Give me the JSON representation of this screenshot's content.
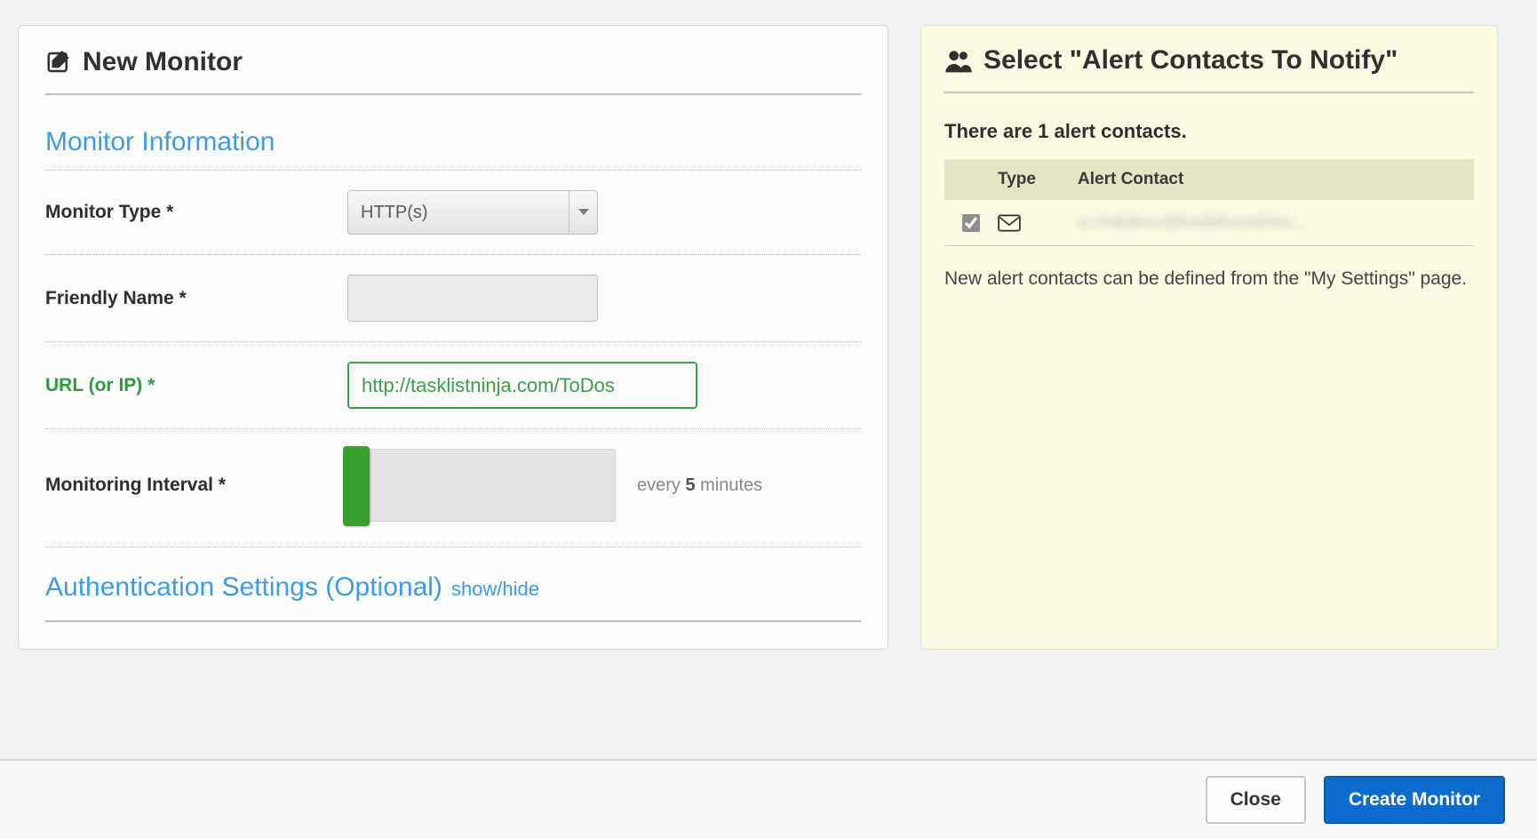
{
  "left": {
    "header": "New Monitor",
    "section_title": "Monitor Information",
    "monitor_type_label": "Monitor Type *",
    "monitor_type_value": "HTTP(s)",
    "friendly_name_label": "Friendly Name *",
    "friendly_name_value": "",
    "url_label": "URL (or IP) *",
    "url_value": "http://tasklistninja.com/ToDos",
    "interval_label": "Monitoring Interval *",
    "interval_caption_prefix": "every ",
    "interval_value": "5",
    "interval_caption_suffix": " minutes",
    "auth_title": "Authentication Settings (Optional)",
    "showhide_label": "show/hide"
  },
  "right": {
    "header": "Select \"Alert Contacts To Notify\"",
    "count_text": "There are 1 alert contacts.",
    "col_type": "Type",
    "col_contact": "Alert Contact",
    "rows": [
      {
        "checked": true,
        "type_icon": "email",
        "address": "a.chalakov@kodefoundries..."
      }
    ],
    "hint": "New alert contacts can be defined from the \"My Settings\" page."
  },
  "footer": {
    "close": "Close",
    "create": "Create Monitor"
  }
}
